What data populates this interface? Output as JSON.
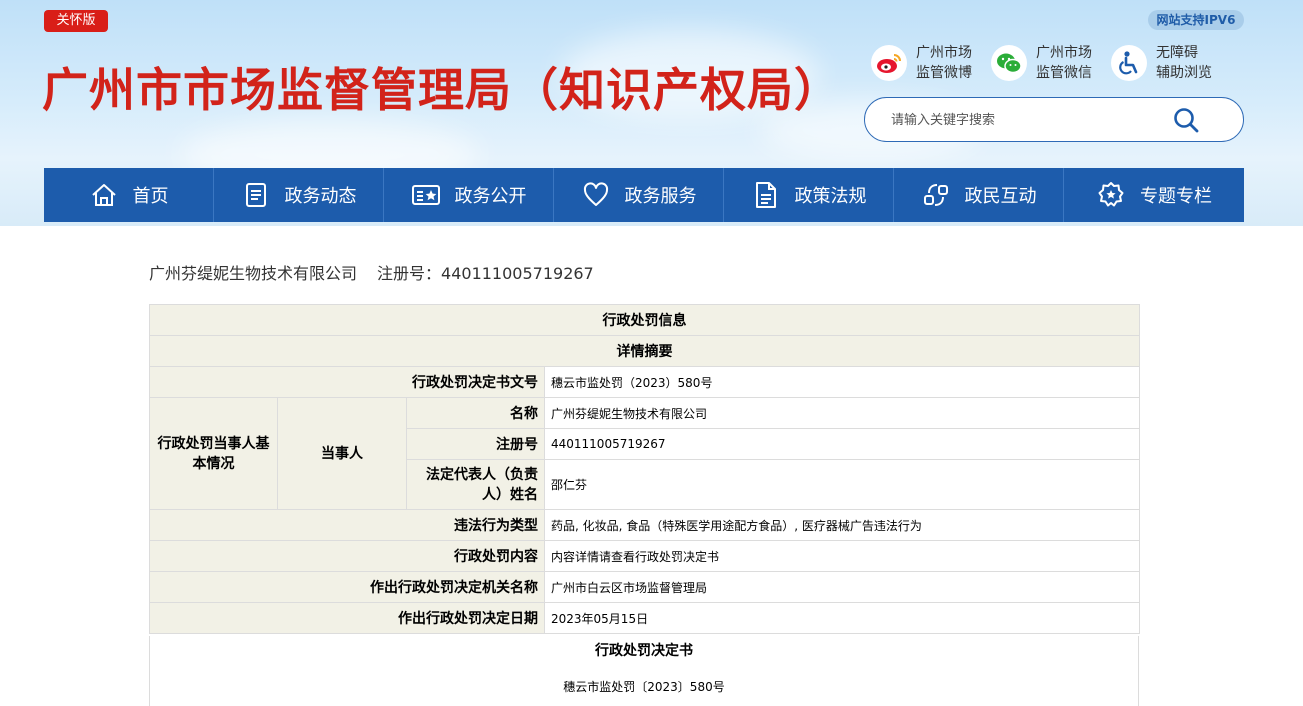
{
  "header": {
    "care_mode_badge": "关怀版",
    "site_title": "广州市市场监督管理局（知识产权局）",
    "ipv6_badge": "网站支持IPV6",
    "quick_links": [
      {
        "line1": "广州市场",
        "line2": "监管微博",
        "icon": "weibo-icon"
      },
      {
        "line1": "广州市场",
        "line2": "监管微信",
        "icon": "wechat-icon"
      },
      {
        "line1": "无障碍",
        "line2": "辅助浏览",
        "icon": "accessibility-icon"
      }
    ],
    "search": {
      "placeholder": "请输入关键字搜索",
      "icon": "search-icon"
    }
  },
  "nav": [
    {
      "label": "首页",
      "icon": "home-icon"
    },
    {
      "label": "政务动态",
      "icon": "news-list-icon"
    },
    {
      "label": "政务公开",
      "icon": "public-star-icon"
    },
    {
      "label": "政务服务",
      "icon": "heart-icon"
    },
    {
      "label": "政策法规",
      "icon": "document-icon"
    },
    {
      "label": "政民互动",
      "icon": "interaction-icon"
    },
    {
      "label": "专题专栏",
      "icon": "badge-star-icon"
    }
  ],
  "company": {
    "name": "广州芬缇妮生物技术有限公司",
    "reg_label": "注册号：",
    "reg_no": "440111005719267"
  },
  "table": {
    "title": "行政处罚信息",
    "section": "详情摘要",
    "decision_no_label": "行政处罚决定书文号",
    "decision_no": "穗云市监处罚（2023）580号",
    "party_group_label": "行政处罚当事人基本情况",
    "party_label": "当事人",
    "name_label": "名称",
    "name_value": "广州芬缇妮生物技术有限公司",
    "reg_label": "注册号",
    "reg_value": "440111005719267",
    "legal_rep_label": "法定代表人（负责人）姓名",
    "legal_rep_value": "邵仁芬",
    "violation_type_label": "违法行为类型",
    "violation_type_value": "药品, 化妆品, 食品（特殊医学用途配方食品）, 医疗器械广告违法行为",
    "penalty_content_label": "行政处罚内容",
    "penalty_content_value": "内容详情请查看行政处罚决定书",
    "authority_label": "作出行政处罚决定机关名称",
    "authority_value": "广州市白云区市场监督管理局",
    "date_label": "作出行政处罚决定日期",
    "date_value": "2023年05月15日"
  },
  "decision": {
    "title": "行政处罚决定书",
    "number": "穗云市监处罚〔2023〕580号"
  },
  "colors": {
    "title_red": "#d2231a",
    "nav_blue": "#1d5cac",
    "table_header_bg": "#f2f1e6"
  }
}
